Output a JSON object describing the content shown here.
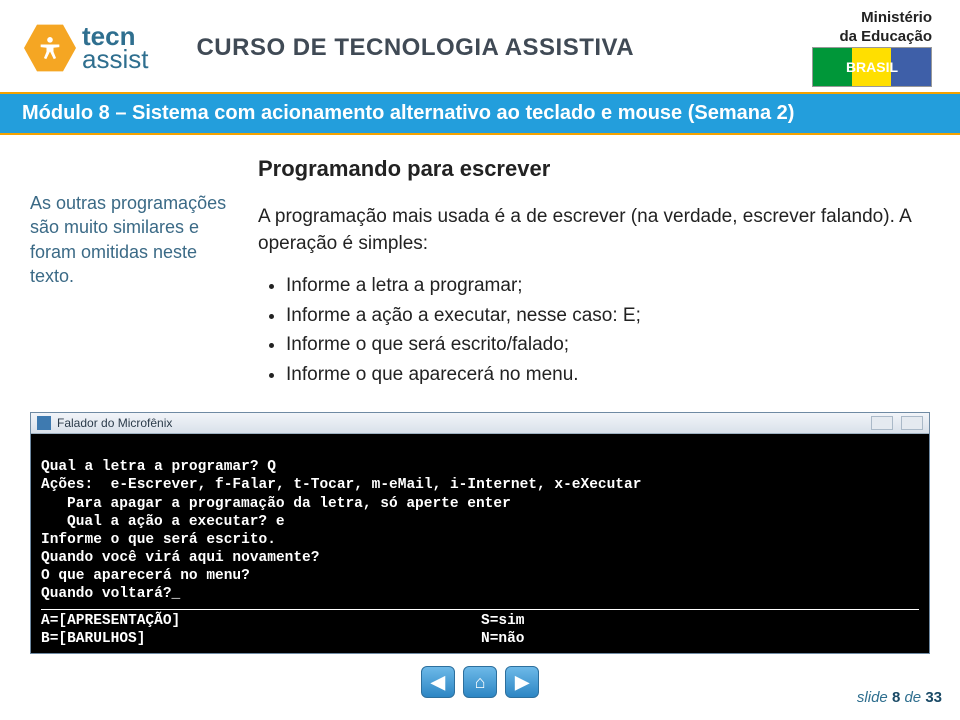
{
  "header": {
    "logo_primary": "tecn",
    "logo_secondary": "assist",
    "course_title": "CURSO DE TECNOLOGIA ASSISTIVA",
    "ministry_line1": "Ministério",
    "ministry_line2": "da Educação",
    "brasil": "BRASIL"
  },
  "module_bar": "Módulo 8 – Sistema com acionamento alternativo ao teclado e mouse (Semana 2)",
  "sidebar": {
    "note": "As outras programações são muito similares e foram omitidas neste texto."
  },
  "main": {
    "heading": "Programando para escrever",
    "paragraph": "A programação mais usada é a de escrever (na verdade, escrever falando). A operação é simples:",
    "bullets": [
      "Informe a letra a programar;",
      "Informe a ação a executar, nesse caso: E;",
      "Informe o que será escrito/falado;",
      "Informe o que aparecerá no menu."
    ]
  },
  "terminal": {
    "window_title": "Falador do Microfênix",
    "lines": {
      "l1": "Qual a letra a programar? Q",
      "l2": "Ações:  e-Escrever, f-Falar, t-Tocar, m-eMail, i-Internet, x-eXecutar",
      "l3": "Para apagar a programação da letra, só aperte enter",
      "l4": "Qual a ação a executar? e",
      "l5": "Informe o que será escrito.",
      "l6": "Quando você virá aqui novamente?",
      "l7": "O que aparecerá no menu?",
      "l8": "Quando voltará?_",
      "foot_a": "A=[APRESENTAÇÃO]",
      "foot_s": "S=sim",
      "foot_b": "B=[BARULHOS]",
      "foot_n": "N=não"
    }
  },
  "nav": {
    "back": "◀",
    "home": "⌂",
    "forward": "▶"
  },
  "footer": {
    "prefix": "slide",
    "current": "8",
    "sep": "de",
    "total": "33"
  }
}
